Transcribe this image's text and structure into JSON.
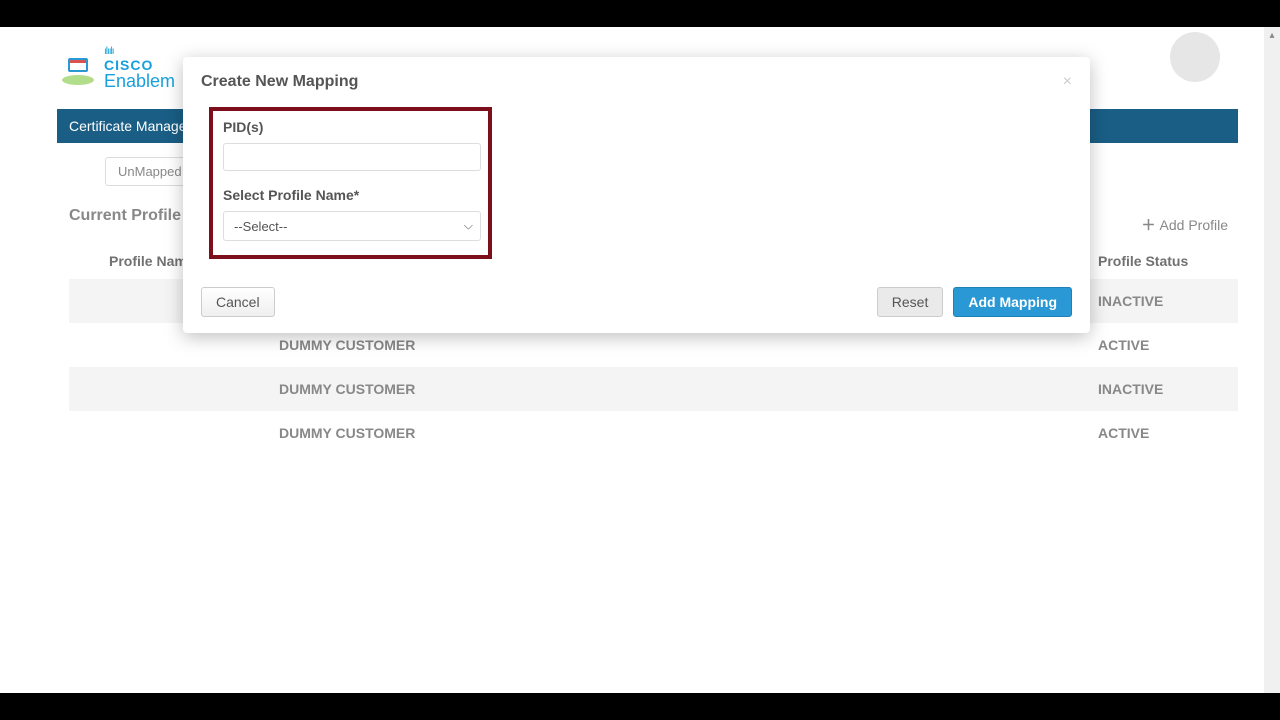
{
  "header": {
    "brand_top": "ılıılı",
    "brand_name": "CISCO",
    "brand_sub": "Enablem"
  },
  "nav": {
    "item1": "Certificate Manageme"
  },
  "page": {
    "unmapped_btn": "UnMapped P",
    "section_title": "Current Profile M",
    "add_profile": "Add Profile",
    "columns": {
      "name": "Profile Name",
      "status": "Profile Status"
    },
    "rows": [
      {
        "name": "",
        "customer": "",
        "status": "INACTIVE",
        "shade": true
      },
      {
        "name": "",
        "customer": "DUMMY CUSTOMER",
        "status": "ACTIVE",
        "shade": false
      },
      {
        "name": "",
        "customer": "DUMMY CUSTOMER",
        "status": "INACTIVE",
        "shade": true
      },
      {
        "name": "",
        "customer": "DUMMY CUSTOMER",
        "status": "ACTIVE",
        "shade": false
      }
    ]
  },
  "modal": {
    "title": "Create New Mapping",
    "close": "×",
    "pid_label": "PID(s)",
    "pid_value": "",
    "profile_label": "Select Profile Name*",
    "select_placeholder": "--Select--",
    "cancel": "Cancel",
    "reset": "Reset",
    "submit": "Add Mapping"
  }
}
